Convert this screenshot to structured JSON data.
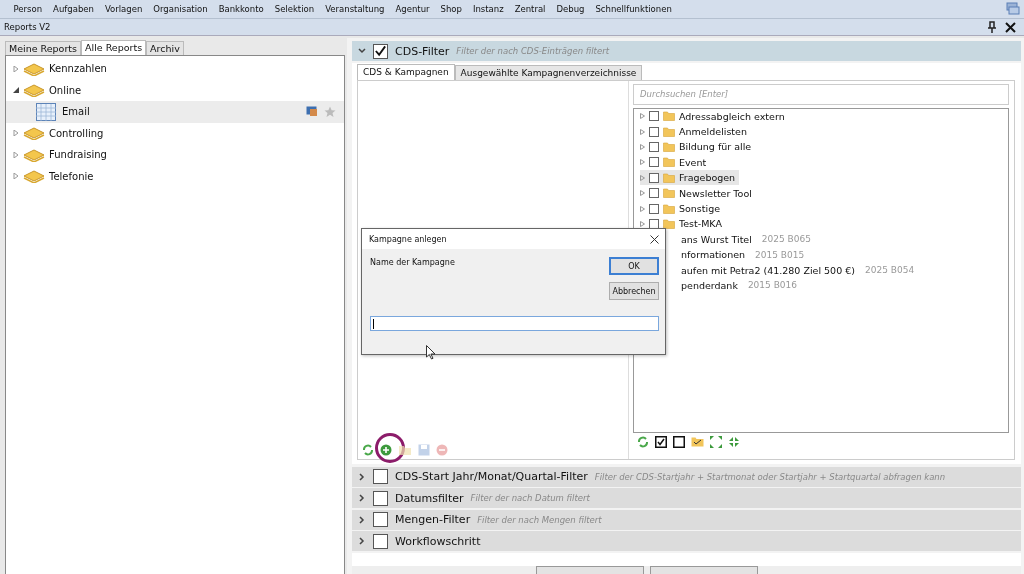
{
  "menu": [
    "Person",
    "Aufgaben",
    "Vorlagen",
    "Organisation",
    "Bankkonto",
    "Selektion",
    "Veranstaltung",
    "Agentur",
    "Shop",
    "Instanz",
    "Zentral",
    "Debug",
    "Schnellfunktionen"
  ],
  "title": "Reports V2",
  "left_tabs": [
    {
      "label": "Meine Reports",
      "selected": false
    },
    {
      "label": "Alle Reports",
      "selected": true
    },
    {
      "label": "Archiv",
      "selected": false
    }
  ],
  "reports": [
    {
      "label": "Kennzahlen",
      "expanded": false
    },
    {
      "label": "Online",
      "expanded": true,
      "children": [
        {
          "label": "Email",
          "selected": true
        }
      ]
    },
    {
      "label": "Controlling",
      "expanded": false
    },
    {
      "label": "Fundraising",
      "expanded": false
    },
    {
      "label": "Telefonie",
      "expanded": false
    }
  ],
  "cds_filter": {
    "title": "CDS-Filter",
    "description": "Filter der nach CDS-Einträgen filtert",
    "checked": true,
    "expanded": true,
    "tabs": [
      {
        "label": "CDS & Kampagnen",
        "selected": true
      },
      {
        "label": "Ausgewählte Kampagnenverzeichnisse",
        "selected": false
      }
    ],
    "search": {
      "placeholder": "Durchsuchen [Enter]"
    },
    "folders": [
      {
        "kind": "folder",
        "label": "Adressabgleich extern",
        "checked": false,
        "selected": false
      },
      {
        "kind": "folder",
        "label": "Anmeldelisten",
        "checked": false,
        "selected": false
      },
      {
        "kind": "folder",
        "label": "Bildung für alle",
        "checked": false,
        "selected": false
      },
      {
        "kind": "folder",
        "label": "Event",
        "checked": false,
        "selected": false
      },
      {
        "kind": "folder",
        "label": "Fragebogen",
        "checked": false,
        "selected": true
      },
      {
        "kind": "folder",
        "label": "Newsletter Tool",
        "checked": false,
        "selected": false
      },
      {
        "kind": "folder",
        "label": "Sonstige",
        "checked": false,
        "selected": false
      },
      {
        "kind": "folder",
        "label": "Test-MKA",
        "checked": false,
        "selected": false
      },
      {
        "kind": "partial",
        "label": "ans Wurst Titel",
        "meta": "2025 B065"
      },
      {
        "kind": "partial",
        "label": "nformationen",
        "meta": "2015 B015"
      },
      {
        "kind": "partial",
        "label": "aufen mit Petra2 (41.280 Ziel 500 €)",
        "meta": "2025 B054"
      },
      {
        "kind": "partial",
        "label": "penderdank",
        "meta": "2015 B016"
      }
    ]
  },
  "other_filters": [
    {
      "title": "CDS-Start Jahr/Monat/Quartal-Filter",
      "description": "Filter der CDS-Startjahr + Startmonat oder Startjahr + Startquartal abfragen kann",
      "checked": false,
      "expanded": false
    },
    {
      "title": "Datumsfilter",
      "description": "Filter der nach Datum filtert",
      "checked": false,
      "expanded": false
    },
    {
      "title": "Mengen-Filter",
      "description": "Filter der nach Mengen filtert",
      "checked": false,
      "expanded": false
    },
    {
      "title": "Workflowschritt",
      "checked": false,
      "expanded": false
    }
  ],
  "dialog": {
    "title": "Kampagne anlegen",
    "prompt": "Name der Kampagne",
    "ok": "OK",
    "cancel": "Abbrechen"
  }
}
